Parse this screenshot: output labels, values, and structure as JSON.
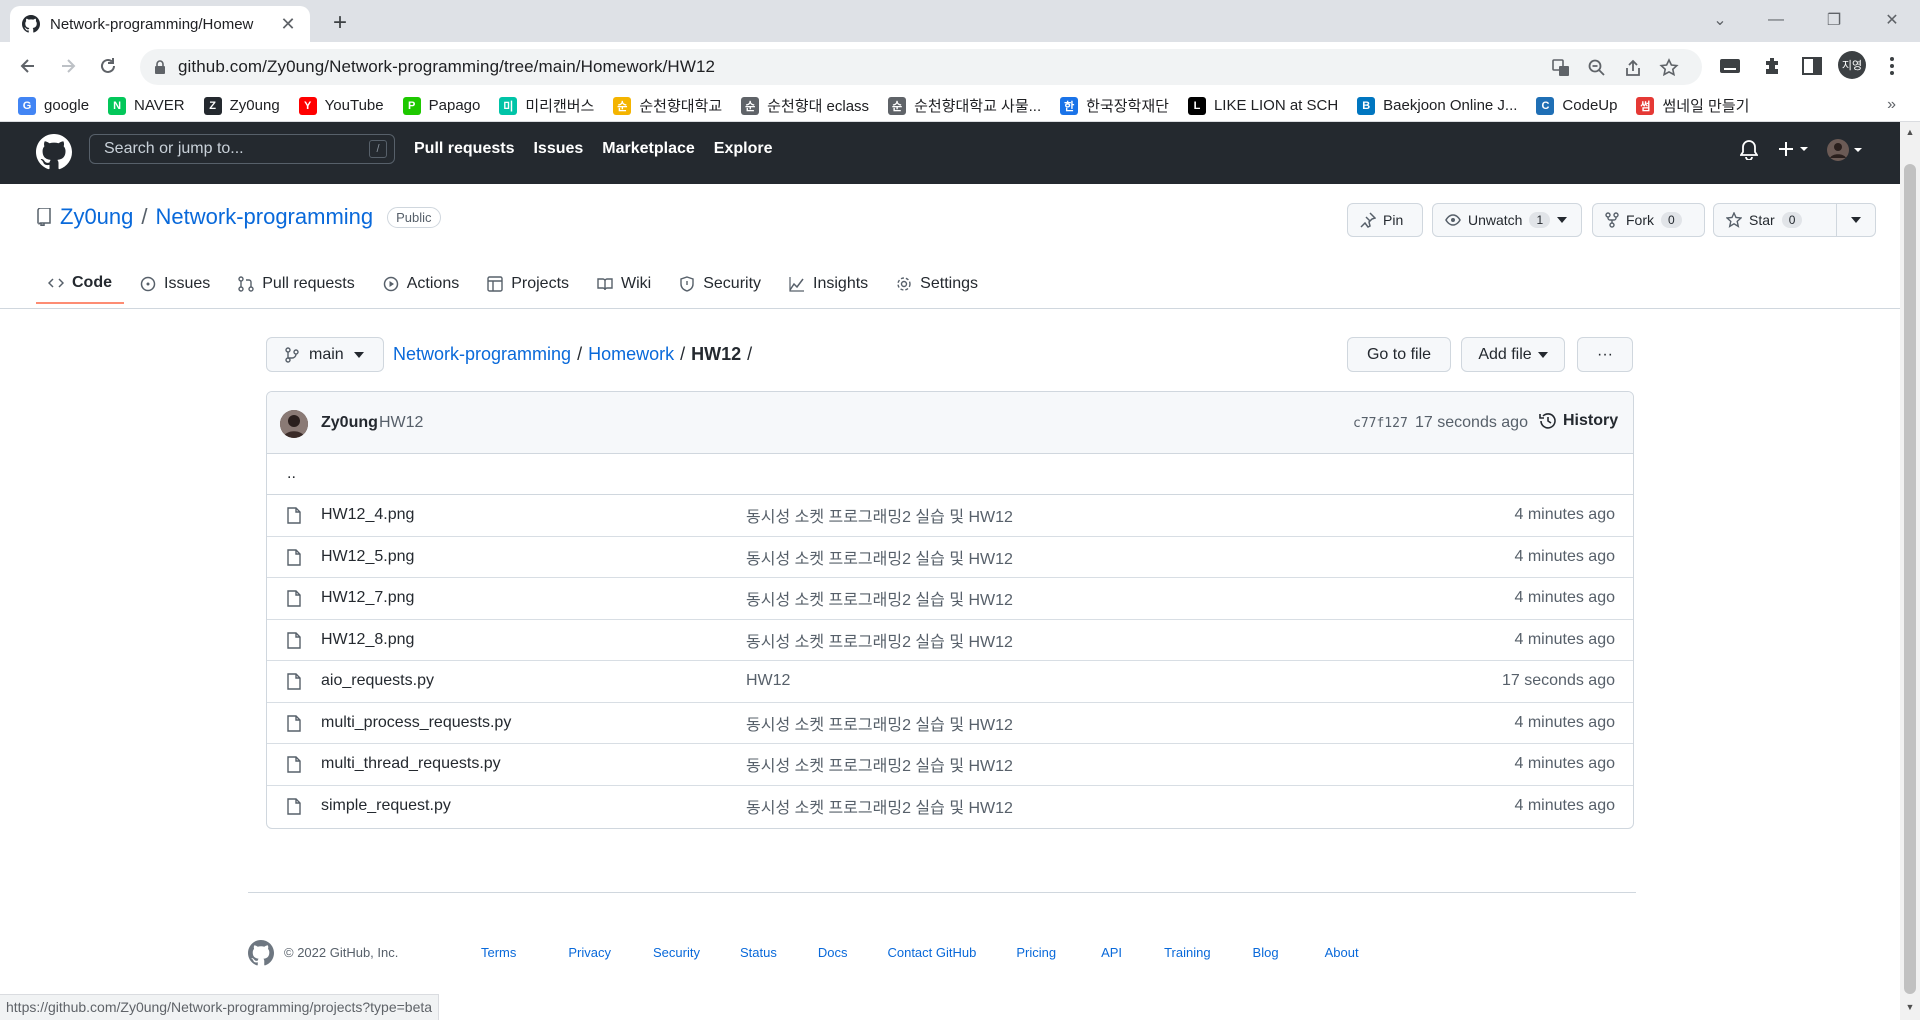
{
  "browser": {
    "tab_title": "Network-programming/Homew",
    "url": "github.com/Zy0ung/Network-programming/tree/main/Homework/HW12",
    "profile_initials": "지영",
    "status_url": "https://github.com/Zy0ung/Network-programming/projects?type=beta"
  },
  "bookmarks": [
    {
      "label": "google",
      "icon": "google-icon",
      "color": "#4285f4"
    },
    {
      "label": "NAVER",
      "icon": "naver-icon",
      "color": "#03c75a"
    },
    {
      "label": "Zy0ung",
      "icon": "github-icon",
      "color": "#24292f"
    },
    {
      "label": "YouTube",
      "icon": "youtube-icon",
      "color": "#ff0000"
    },
    {
      "label": "Papago",
      "icon": "papago-icon",
      "color": "#1ec800"
    },
    {
      "label": "미리캔버스",
      "icon": "miricanvas-icon",
      "color": "#00c4a7"
    },
    {
      "label": "순천향대학교",
      "icon": "sch-icon",
      "color": "#f4b400"
    },
    {
      "label": "순천향대 eclass",
      "icon": "globe-icon",
      "color": "#5f6368"
    },
    {
      "label": "순천향대학교 사물...",
      "icon": "globe-icon",
      "color": "#5f6368"
    },
    {
      "label": "한국장학재단",
      "icon": "kosaf-icon",
      "color": "#1a73e8"
    },
    {
      "label": "LIKE LION at SCH",
      "icon": "notion-icon",
      "color": "#000000"
    },
    {
      "label": "Baekjoon Online J...",
      "icon": "baekjoon-icon",
      "color": "#0076c0"
    },
    {
      "label": "CodeUp",
      "icon": "codeup-icon",
      "color": "#1f6fb5"
    },
    {
      "label": "썸네일 만들기",
      "icon": "thumbnail-icon",
      "color": "#e53935"
    }
  ],
  "header": {
    "search_placeholder": "Search or jump to...",
    "slash": "/",
    "nav": [
      "Pull requests",
      "Issues",
      "Marketplace",
      "Explore"
    ]
  },
  "repo": {
    "owner": "Zy0ung",
    "name": "Network-programming",
    "visibility": "Public",
    "pin": "Pin",
    "unwatch": "Unwatch",
    "watch_count": "1",
    "fork": "Fork",
    "fork_count": "0",
    "star": "Star",
    "star_count": "0",
    "tabs": [
      "Code",
      "Issues",
      "Pull requests",
      "Actions",
      "Projects",
      "Wiki",
      "Security",
      "Insights",
      "Settings"
    ]
  },
  "filenav": {
    "branch": "main",
    "crumb_root": "Network-programming",
    "crumb_mid": "Homework",
    "crumb_current": "HW12",
    "go_to_file": "Go to file",
    "add_file": "Add file",
    "more": "···"
  },
  "commit": {
    "user": "Zy0ung",
    "message": "HW12",
    "sha": "c77f127",
    "time": "17 seconds ago",
    "history": "History"
  },
  "files": {
    "up": "..",
    "rows": [
      {
        "name": "HW12_4.png",
        "msg": "동시성 소켓 프로그래밍2 실습 및 HW12",
        "time": "4 minutes ago"
      },
      {
        "name": "HW12_5.png",
        "msg": "동시성 소켓 프로그래밍2 실습 및 HW12",
        "time": "4 minutes ago"
      },
      {
        "name": "HW12_7.png",
        "msg": "동시성 소켓 프로그래밍2 실습 및 HW12",
        "time": "4 minutes ago"
      },
      {
        "name": "HW12_8.png",
        "msg": "동시성 소켓 프로그래밍2 실습 및 HW12",
        "time": "4 minutes ago"
      },
      {
        "name": "aio_requests.py",
        "msg": "HW12",
        "time": "17 seconds ago"
      },
      {
        "name": "multi_process_requests.py",
        "msg": "동시성 소켓 프로그래밍2 실습 및 HW12",
        "time": "4 minutes ago"
      },
      {
        "name": "multi_thread_requests.py",
        "msg": "동시성 소켓 프로그래밍2 실습 및 HW12",
        "time": "4 minutes ago"
      },
      {
        "name": "simple_request.py",
        "msg": "동시성 소켓 프로그래밍2 실습 및 HW12",
        "time": "4 minutes ago"
      }
    ]
  },
  "footer": {
    "copyright": "© 2022 GitHub, Inc.",
    "links": [
      "Terms",
      "Privacy",
      "Security",
      "Status",
      "Docs",
      "Contact GitHub",
      "Pricing",
      "API",
      "Training",
      "Blog",
      "About"
    ]
  }
}
